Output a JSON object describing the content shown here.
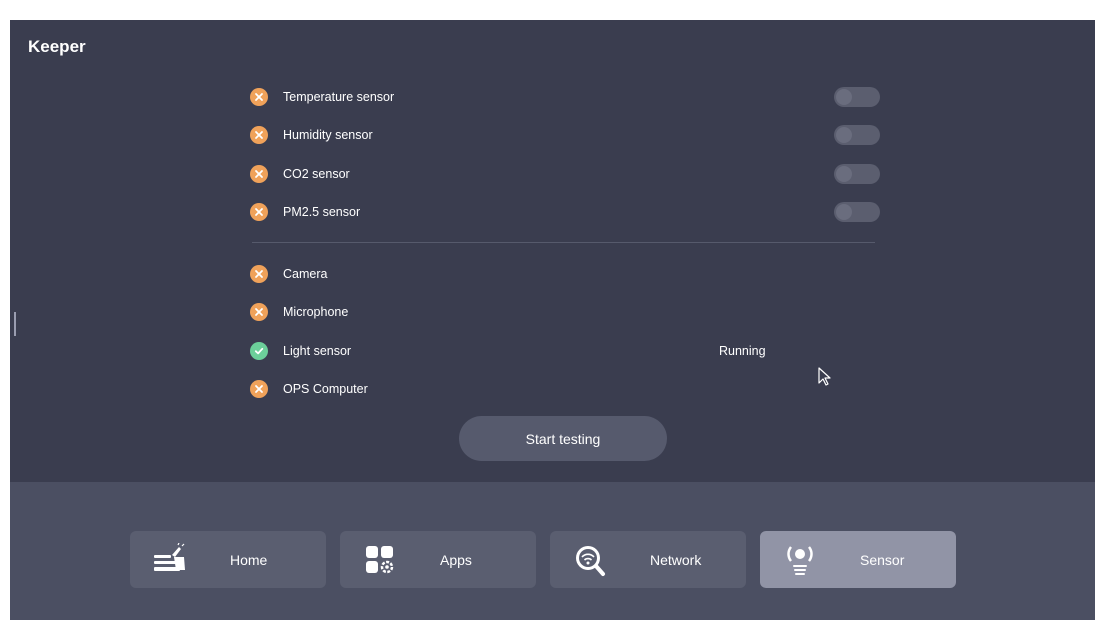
{
  "app": {
    "title": "Keeper"
  },
  "colors": {
    "background": "#3a3d4f",
    "bottom_bar": "#4b4f62",
    "status_fail": "#f0a25a",
    "status_ok": "#6ccf9a",
    "toggle_track": "#5b5e6f",
    "active_tab": "#9194a6"
  },
  "sensors": [
    {
      "label": "Temperature sensor",
      "status": "fail",
      "icon": "x-circle-icon",
      "toggle": "off"
    },
    {
      "label": "Humidity sensor",
      "status": "fail",
      "icon": "x-circle-icon",
      "toggle": "off"
    },
    {
      "label": "CO2 sensor",
      "status": "fail",
      "icon": "x-circle-icon",
      "toggle": "off"
    },
    {
      "label": "PM2.5 sensor",
      "status": "fail",
      "icon": "x-circle-icon",
      "toggle": "off"
    }
  ],
  "devices": [
    {
      "label": "Camera",
      "status": "fail",
      "icon": "x-circle-icon"
    },
    {
      "label": "Microphone",
      "status": "fail",
      "icon": "x-circle-icon"
    },
    {
      "label": "Light sensor",
      "status": "ok",
      "icon": "check-circle-icon",
      "state_text": "Running"
    },
    {
      "label": "OPS Computer",
      "status": "fail",
      "icon": "x-circle-icon"
    }
  ],
  "actions": {
    "start_testing": "Start testing"
  },
  "nav": {
    "tabs": [
      {
        "label": "Home",
        "icon": "cleaning-broom-icon",
        "active": false
      },
      {
        "label": "Apps",
        "icon": "apps-grid-gear-icon",
        "active": false
      },
      {
        "label": "Network",
        "icon": "wifi-magnifier-icon",
        "active": false
      },
      {
        "label": "Sensor",
        "icon": "sensor-signal-icon",
        "active": true
      }
    ]
  }
}
